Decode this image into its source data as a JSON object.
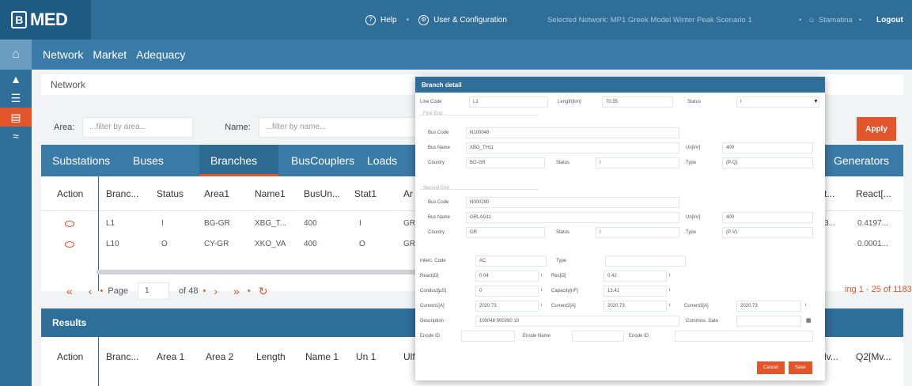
{
  "app": {
    "logo_text": "MED"
  },
  "topbar": {
    "help": "Help",
    "user_config": "User & Configuration",
    "network_status": "Selected Network: MP1 Greek Model Winter Peak Scenario 1",
    "user": "Stamatina",
    "logout": "Logout"
  },
  "nav": {
    "items": [
      "Network",
      "Market",
      "Adequacy"
    ]
  },
  "breadcrumb": "Network",
  "filters": {
    "area_label": "Area:",
    "area_placeholder": "...filter by area...",
    "name_label": "Name:",
    "name_placeholder": "...filter by name...",
    "apply": "Apply"
  },
  "tabs": [
    "Substations",
    "Buses",
    "Branches",
    "BusCouplers",
    "Loads",
    "Generators"
  ],
  "grid": {
    "columns": [
      "Action",
      "Branc...",
      "Status",
      "Area1",
      "Name1",
      "BusUn...",
      "Stat1",
      "Ar",
      "st...",
      "React[..."
    ],
    "rows": [
      {
        "branch": "L1",
        "status": "I",
        "area1": "BG-GR",
        "name1": "XBG_T...",
        "busun": "400",
        "stat1": "I",
        "ar": "GR",
        "st": "3...",
        "react": "0.4197..."
      },
      {
        "branch": "L10",
        "status": "O",
        "area1": "CY-GR",
        "name1": "XKO_VA",
        "busun": "400",
        "stat1": "O",
        "ar": "GR",
        "st": "",
        "react": "0.0001..."
      }
    ]
  },
  "pager": {
    "page_label": "Page",
    "page_value": "1",
    "of_label": "of 48",
    "info": "ing 1 - 25 of 1183"
  },
  "results": {
    "title": "Results",
    "columns": [
      "Action",
      "Branc...",
      "Area 1",
      "Area 2",
      "Length",
      "Name 1",
      "Un 1",
      "Ulf",
      "lv...",
      "Q2[Mv..."
    ]
  },
  "dialog": {
    "title": "Branch detail",
    "line_code_label": "Line Code",
    "line_code": "L1",
    "length_label": "Length[km]",
    "length": "70.55",
    "status_label": "Status",
    "status": "I",
    "first_end": "First End",
    "second_end": "Second End",
    "bus_code_label": "Bus Code",
    "bus_name_label": "Bus Name",
    "country_label": "Country",
    "un_label": "Un[kV]",
    "type_label": "Type",
    "first": {
      "bus_code": "N100048",
      "bus_name": "XBG_TH11",
      "country": "BG-GR",
      "status": "I",
      "un": "400",
      "type": "(P-Q)"
    },
    "second": {
      "bus_code": "N000280",
      "bus_name": "GRLAG11",
      "country": "GR",
      "status": "I",
      "un": "400",
      "type": "(P-V)"
    },
    "interc_code_label": "Interc. Code",
    "interc_code": "AC",
    "type2_label": "Type",
    "react_label": "React[Ω]",
    "react": "0.04",
    "res_label": "Res[Ω]",
    "res": "0.42",
    "conduct_label": "Conduct[µS]",
    "conduct": "0",
    "capacity_label": "Capacity[nF]",
    "capacity": "13.41",
    "current1_label": "Current1[A]",
    "current1": "2020.73",
    "current2_label": "Current2[A]",
    "current2": "2020.73",
    "current3_label": "Current3[A]",
    "current3": "2020.73",
    "description_label": "Description",
    "description": "100048 000280 10",
    "commiss_label": "Commiss. Date",
    "enode_id_label": "Enode ID",
    "enode_name_label": "Enode Name",
    "enode_id2_label": "Enode ID",
    "cancel": "Cancel",
    "save": "Save"
  }
}
